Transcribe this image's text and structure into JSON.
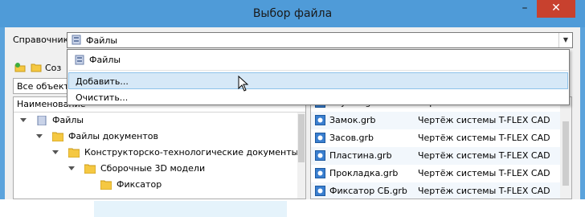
{
  "window": {
    "title": "Выбор файла",
    "minimize_glyph": "–",
    "close_glyph": "✕"
  },
  "reference": {
    "label": "Справочник",
    "value": "Файлы",
    "arrow_glyph": "▼"
  },
  "toolbar": {
    "create_label_partial": "Соз"
  },
  "filter": {
    "value_partial": "Все объекть"
  },
  "dropdown": {
    "items": [
      {
        "label": "Файлы",
        "icon": "library-icon"
      },
      {
        "label": "Добавить...",
        "state": "hover"
      },
      {
        "label": "Очистить..."
      }
    ]
  },
  "tree": {
    "header": "Наименование",
    "nodes": [
      {
        "label": "Файлы",
        "icon": "library-icon"
      },
      {
        "label": "Файлы документов",
        "icon": "folder-icon"
      },
      {
        "label": "Конструкторско-технологические документы",
        "icon": "folder-icon"
      },
      {
        "label": "Сборочные 3D модели",
        "icon": "folder-icon"
      },
      {
        "label": "Фиксатор",
        "icon": "folder-icon",
        "selected": true
      }
    ]
  },
  "files": {
    "rows": [
      {
        "name": "Втулка.grb",
        "type": "Чертёж системы T-FLEX CAD"
      },
      {
        "name": "Замок.grb",
        "type": "Чертёж системы T-FLEX CAD"
      },
      {
        "name": "Засов.grb",
        "type": "Чертёж системы T-FLEX CAD"
      },
      {
        "name": "Пластина.grb",
        "type": "Чертёж системы T-FLEX CAD"
      },
      {
        "name": "Прокладка.grb",
        "type": "Чертёж системы T-FLEX CAD"
      },
      {
        "name": "Фиксатор СБ.grb",
        "type": "Чертёж системы T-FLEX CAD"
      }
    ]
  },
  "colors": {
    "title_bar": "#4f9bd8",
    "close_button": "#c8412e",
    "hover": "#d6e8f7",
    "folder": "#f5c842"
  }
}
